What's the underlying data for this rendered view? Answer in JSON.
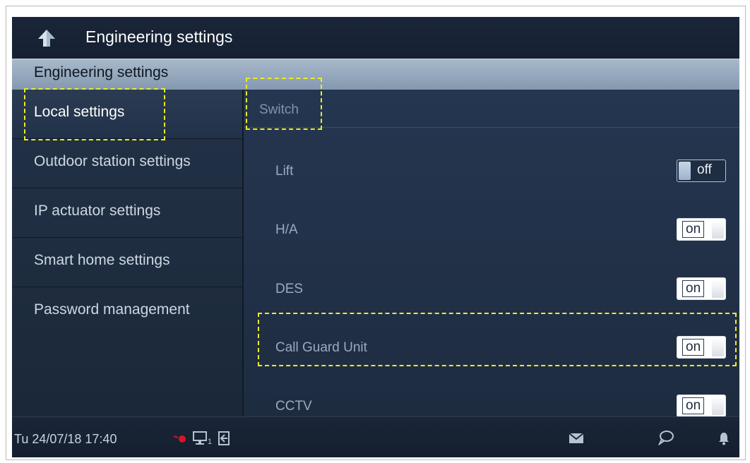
{
  "window": {
    "title": "Engineering settings"
  },
  "section": {
    "title": "Engineering settings"
  },
  "menu": {
    "items": [
      {
        "label": "Local settings"
      },
      {
        "label": "Outdoor station settings"
      },
      {
        "label": "IP actuator settings"
      },
      {
        "label": "Smart home settings"
      },
      {
        "label": "Password management"
      }
    ]
  },
  "panel": {
    "header": "Switch",
    "rows": [
      {
        "label": "Lift",
        "state": "off"
      },
      {
        "label": "H/A",
        "state": "on"
      },
      {
        "label": "DES",
        "state": "on"
      },
      {
        "label": "Call Guard Unit",
        "state": "on"
      },
      {
        "label": "CCTV",
        "state": "on"
      }
    ]
  },
  "statusbar": {
    "datetime": "Tu 24/07/18  17:40",
    "monitor_count": "1",
    "icons": [
      "alarm-dot-icon",
      "monitor-icon",
      "door-exit-icon",
      "mail-icon",
      "chat-bubble-icon",
      "bell-icon"
    ]
  },
  "colors": {
    "highlight": "#ecec24",
    "background": "#1b2637",
    "header_bar": "#9aacc0",
    "alert_red": "#e0102a"
  }
}
